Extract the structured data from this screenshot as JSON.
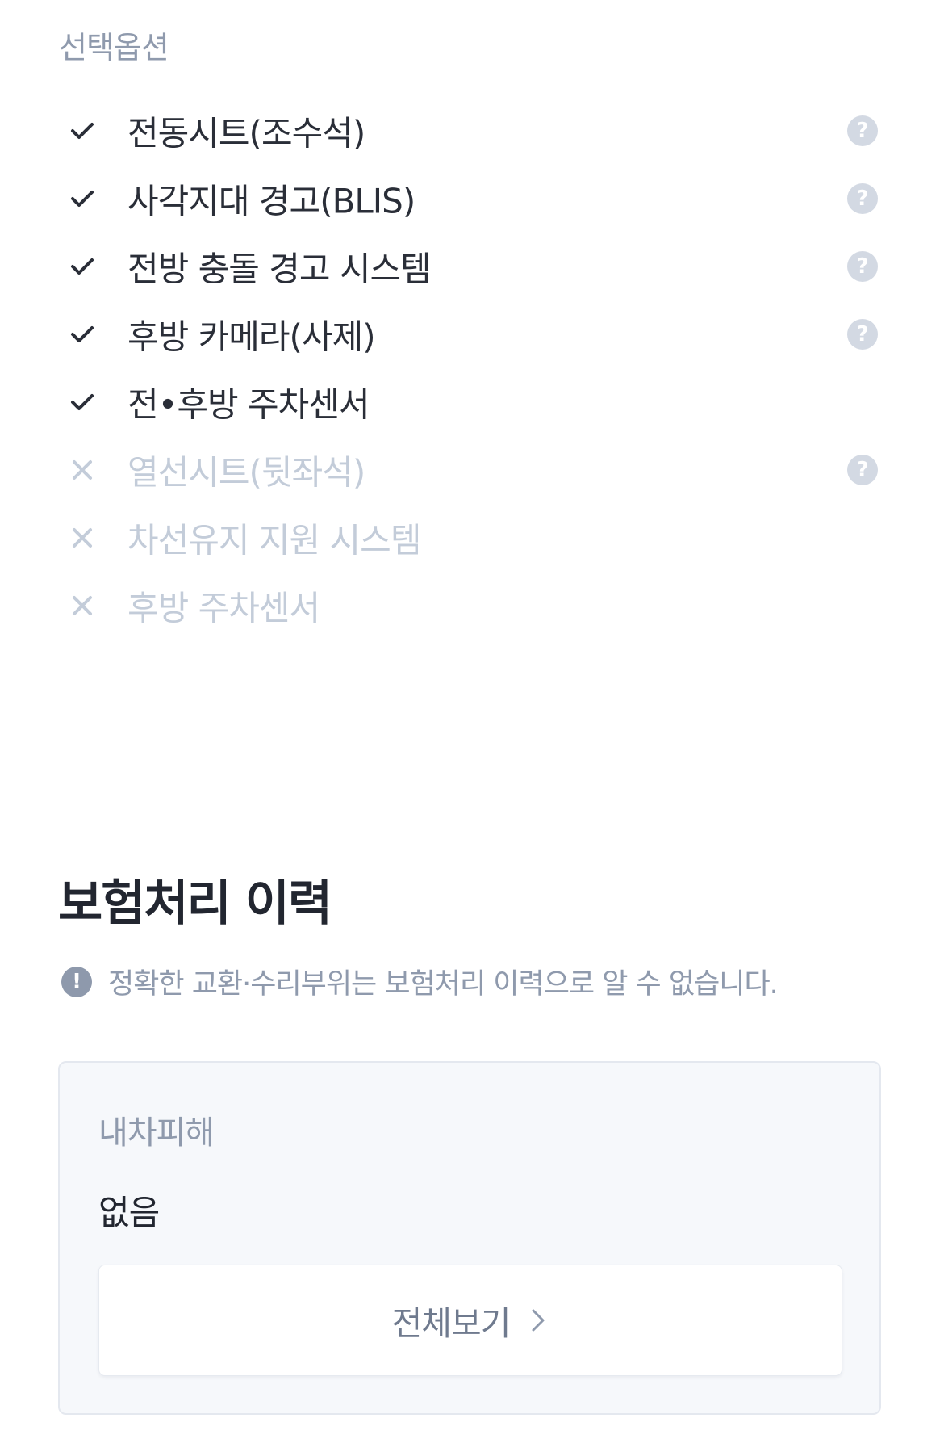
{
  "options_section": {
    "label": "선택옵션",
    "items": [
      {
        "label": "전동시트(조수석)",
        "available": true,
        "has_help": true
      },
      {
        "label": "사각지대 경고(BLIS)",
        "available": true,
        "has_help": true
      },
      {
        "label": "전방 충돌 경고 시스템",
        "available": true,
        "has_help": true
      },
      {
        "label": "후방 카메라(사제)",
        "available": true,
        "has_help": true
      },
      {
        "label": "전•후방 주차센서",
        "available": true,
        "has_help": false
      },
      {
        "label": "열선시트(뒷좌석)",
        "available": false,
        "has_help": true
      },
      {
        "label": "차선유지 지원 시스템",
        "available": false,
        "has_help": false
      },
      {
        "label": "후방 주차센서",
        "available": false,
        "has_help": false
      }
    ],
    "icons": {
      "available": "check-icon",
      "unavailable": "x-icon",
      "help": "question-icon"
    }
  },
  "insurance_history": {
    "title": "보험처리 이력",
    "notice": {
      "icon": "exclamation-icon",
      "text": "정확한 교환·수리부위는 보험처리 이력으로 알 수 없습니다."
    },
    "card": {
      "label": "내차피해",
      "value": "없음",
      "view_all_label": "전체보기",
      "view_all_icon": "chevron-right-icon"
    }
  },
  "colors": {
    "text_primary": "#2a2e38",
    "text_muted": "#8f9aad",
    "text_disabled": "#c3ccd9",
    "help_icon_bg": "#d3d9e3",
    "card_bg": "#f6f8fb"
  }
}
